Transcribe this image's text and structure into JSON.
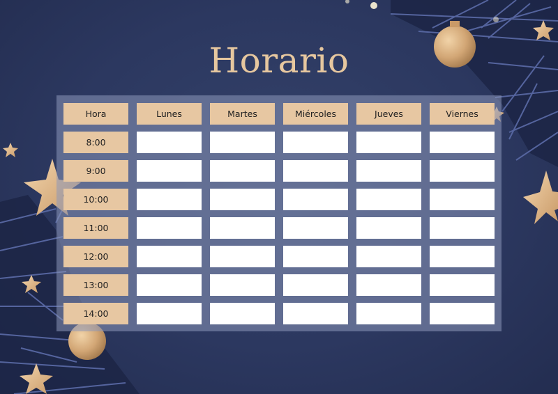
{
  "title": "Horario",
  "colors": {
    "background": "#2c3860",
    "title": "#e6c79f",
    "header_cell": "#e7c7a2",
    "slot_cell": "#ffffff",
    "panel": "#6a7596"
  },
  "schedule": {
    "headers": [
      "Hora",
      "Lunes",
      "Martes",
      "Miércoles",
      "Jueves",
      "Viernes"
    ],
    "times": [
      "8:00",
      "9:00",
      "10:00",
      "11:00",
      "12:00",
      "13:00",
      "14:00"
    ],
    "slots": [
      [
        "",
        "",
        "",
        "",
        ""
      ],
      [
        "",
        "",
        "",
        "",
        ""
      ],
      [
        "",
        "",
        "",
        "",
        ""
      ],
      [
        "",
        "",
        "",
        "",
        ""
      ],
      [
        "",
        "",
        "",
        "",
        ""
      ],
      [
        "",
        "",
        "",
        "",
        ""
      ],
      [
        "",
        "",
        "",
        "",
        ""
      ]
    ]
  },
  "decorations": [
    "pine-branch",
    "gold-ornament",
    "gold-star",
    "string-light"
  ]
}
